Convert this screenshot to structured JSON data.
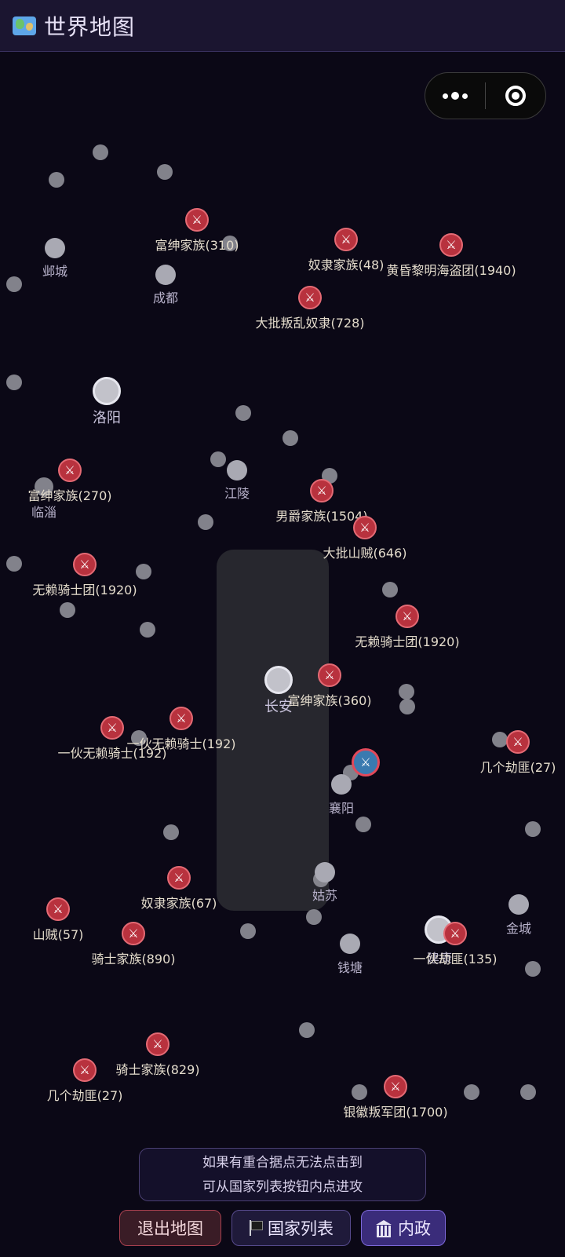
{
  "header": {
    "title": "世界地图",
    "icon": "world-map-icon"
  },
  "miniprogram_capsule": {
    "more_icon": "more-dots-icon",
    "close_icon": "target-close-icon"
  },
  "cities": [
    {
      "name": "邺城"
    },
    {
      "name": "成都"
    },
    {
      "name": "洛阳"
    },
    {
      "name": "临淄"
    },
    {
      "name": "江陵"
    },
    {
      "name": "长安"
    },
    {
      "name": "襄阳"
    },
    {
      "name": "姑苏"
    },
    {
      "name": "金城"
    },
    {
      "name": "钱塘"
    },
    {
      "name": "建康"
    }
  ],
  "enemies": [
    {
      "name": "富绅家族(310)"
    },
    {
      "name": "奴隶家族(48)"
    },
    {
      "name": "黄昏黎明海盗团(1940)"
    },
    {
      "name": "大批叛乱奴隶(728)"
    },
    {
      "name": "富绅家族(270)"
    },
    {
      "name": "男爵家族(1504)"
    },
    {
      "name": "大批山贼(646)"
    },
    {
      "name": "无赖骑士团(1920)"
    },
    {
      "name": "无赖骑士团(1920)"
    },
    {
      "name": "富绅家族(360)"
    },
    {
      "name": "一伙无赖骑士(192)"
    },
    {
      "name": "一伙无赖骑士(192)"
    },
    {
      "name": "几个劫匪(27)"
    },
    {
      "name": "奴隶家族(67)"
    },
    {
      "name": "山贼(57)"
    },
    {
      "name": "骑士家族(890)"
    },
    {
      "name": "一伙劫匪(135)"
    },
    {
      "name": "骑士家族(829)"
    },
    {
      "name": "几个劫匪(27)"
    },
    {
      "name": "银徽叛军团(1700)"
    },
    {
      "name": ""
    }
  ],
  "notice": {
    "line1": "如果有重合据点无法点击到",
    "line2": "可从国家列表按钮内点进攻"
  },
  "buttons": {
    "exit": "退出地图",
    "country_list": "国家列表",
    "internal": "内政"
  },
  "colors": {
    "background": "#0b0816",
    "enemy": "#b8323e",
    "accent": "#7d68d8"
  }
}
